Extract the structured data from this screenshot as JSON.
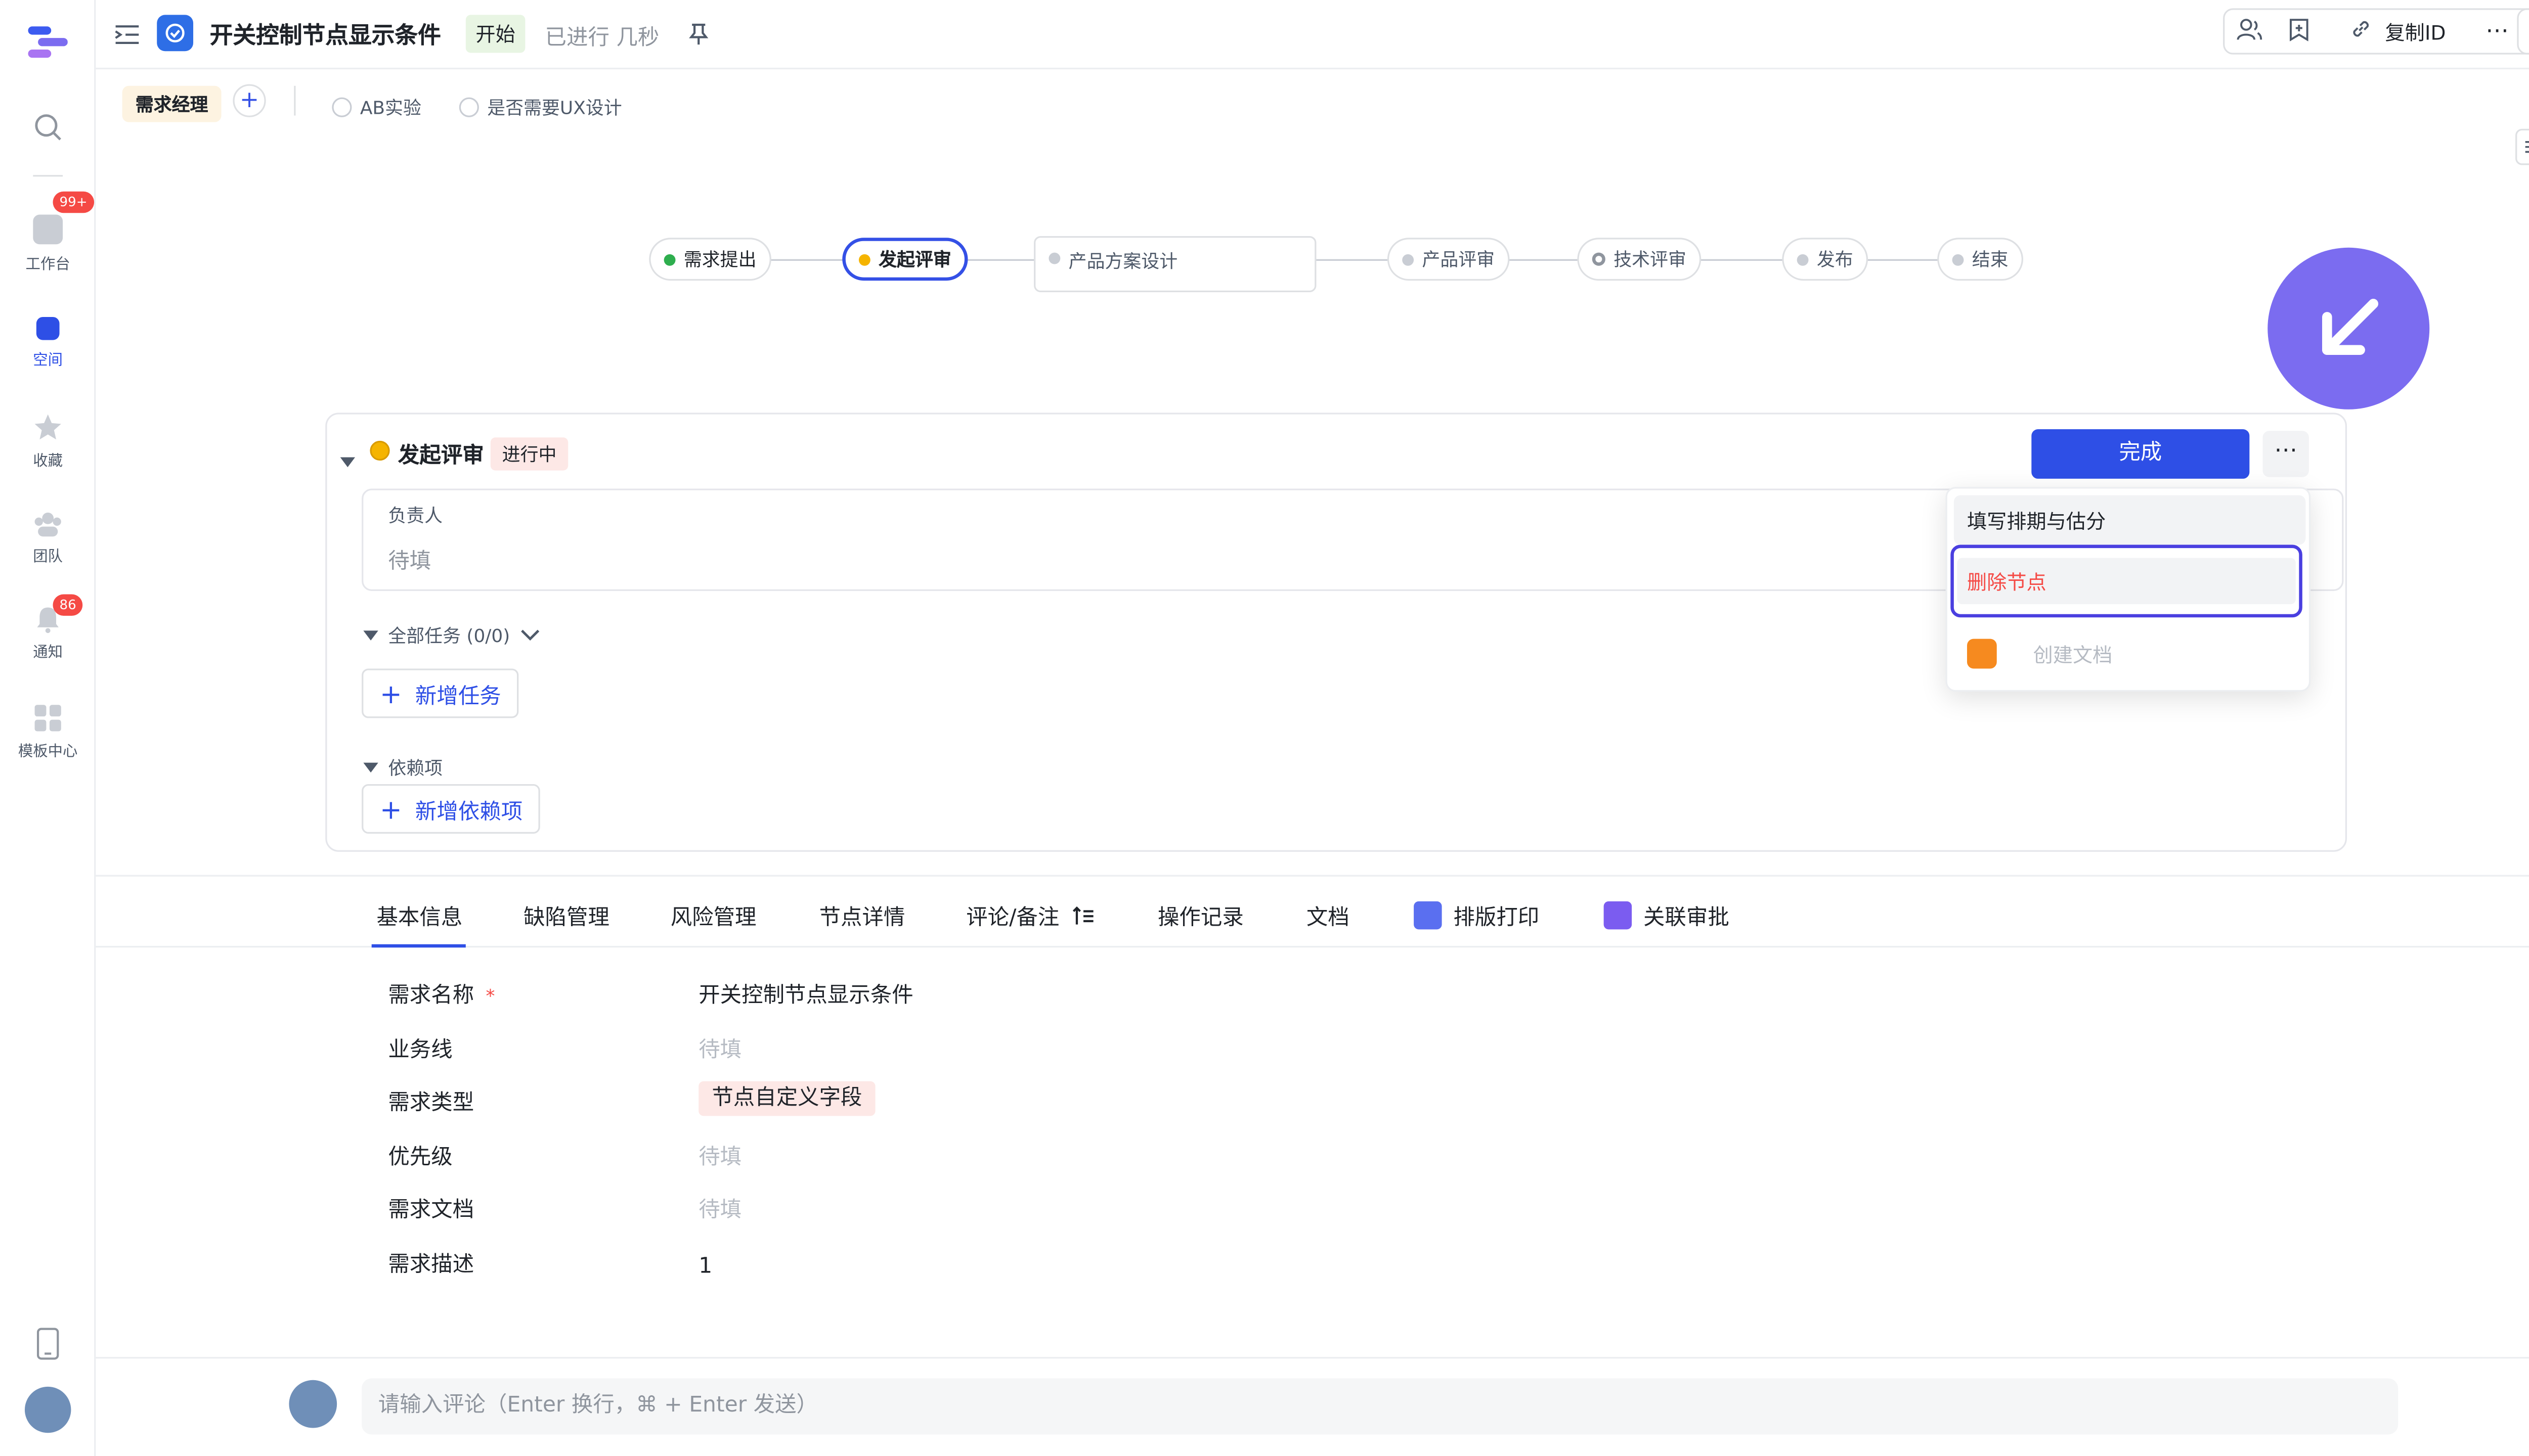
{
  "header": {
    "title": "开关控制节点显示条件",
    "status_tag": "开始",
    "elapsed": "已进行 几秒",
    "copy_id_label": "复制ID"
  },
  "rail": {
    "items": [
      {
        "label": "工作台",
        "badge": "99+"
      },
      {
        "label": "空间"
      },
      {
        "label": "收藏"
      },
      {
        "label": "团队"
      },
      {
        "label": "通知",
        "badge": "86"
      },
      {
        "label": "模板中心"
      }
    ]
  },
  "subheader": {
    "role_tag": "需求经理",
    "options": [
      "AB实验",
      "是否需要UX设计"
    ]
  },
  "workflow": {
    "nodes": [
      {
        "label": "需求提出",
        "state": "done",
        "color": "#2eae4e"
      },
      {
        "label": "发起评审",
        "state": "active",
        "color": "#f5b400"
      },
      {
        "label": "产品方案设计",
        "state": "pending",
        "color": "#c9cdd4"
      },
      {
        "label": "产品评审",
        "state": "pending",
        "color": "#c9cdd4"
      },
      {
        "label": "技术评审",
        "state": "pending",
        "color": "#8f959e"
      },
      {
        "label": "发布",
        "state": "pending",
        "color": "#c9cdd4"
      },
      {
        "label": "结束",
        "state": "pending",
        "color": "#c9cdd4"
      }
    ]
  },
  "node_card": {
    "title": "发起评审",
    "status": "进行中",
    "complete_button": "完成",
    "owner_label": "负责人",
    "owner_placeholder": "待填",
    "tasks_header": "全部任务 (0/0)",
    "add_task": "新增任务",
    "deps_header": "依赖项",
    "add_dep": "新增依赖项"
  },
  "menu": {
    "items": [
      {
        "label": "填写排期与估分",
        "state": "hover"
      },
      {
        "label": "删除节点",
        "state": "focused-danger"
      },
      {
        "label": "创建文档",
        "state": "disabled"
      }
    ]
  },
  "tabs": {
    "items": [
      "基本信息",
      "缺陷管理",
      "风险管理",
      "节点详情",
      "评论/备注",
      "操作记录",
      "文档",
      "排版打印",
      "关联审批"
    ],
    "active_index": 0
  },
  "info": {
    "rows": [
      {
        "label": "需求名称",
        "required": "*",
        "value": "开关控制节点显示条件",
        "kind": "text"
      },
      {
        "label": "业务线",
        "value": "待填",
        "kind": "placeholder"
      },
      {
        "label": "需求类型",
        "value": "节点自定义字段",
        "kind": "tag"
      },
      {
        "label": "优先级",
        "value": "待填",
        "kind": "placeholder"
      },
      {
        "label": "需求文档",
        "value": "待填",
        "kind": "placeholder"
      },
      {
        "label": "需求描述",
        "value": "1",
        "kind": "text"
      }
    ]
  },
  "comment": {
    "placeholder": "请输入评论（Enter 换行，⌘ + Enter 发送）"
  },
  "colors": {
    "accent": "#2e4fe6",
    "danger": "#f54a45",
    "fab": "#7b6cf0"
  }
}
